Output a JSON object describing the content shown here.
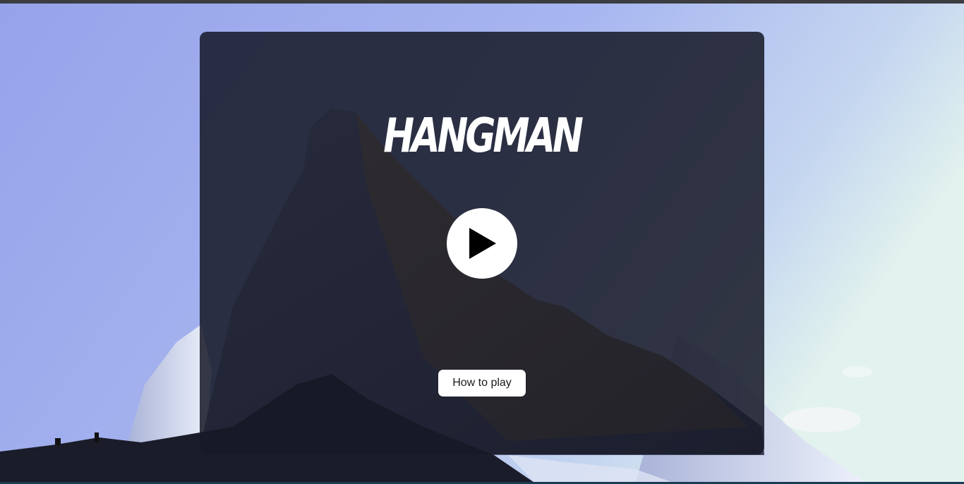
{
  "game": {
    "title": "HANGMAN",
    "play_icon": "play-icon",
    "how_to_play_label": "How to play"
  },
  "colors": {
    "panel_overlay": "#161926",
    "button_background": "#ffffff",
    "play_triangle": "#000000",
    "title_text": "#ffffff",
    "sky_top": "#97a6ec",
    "sky_right": "#dcefee"
  }
}
